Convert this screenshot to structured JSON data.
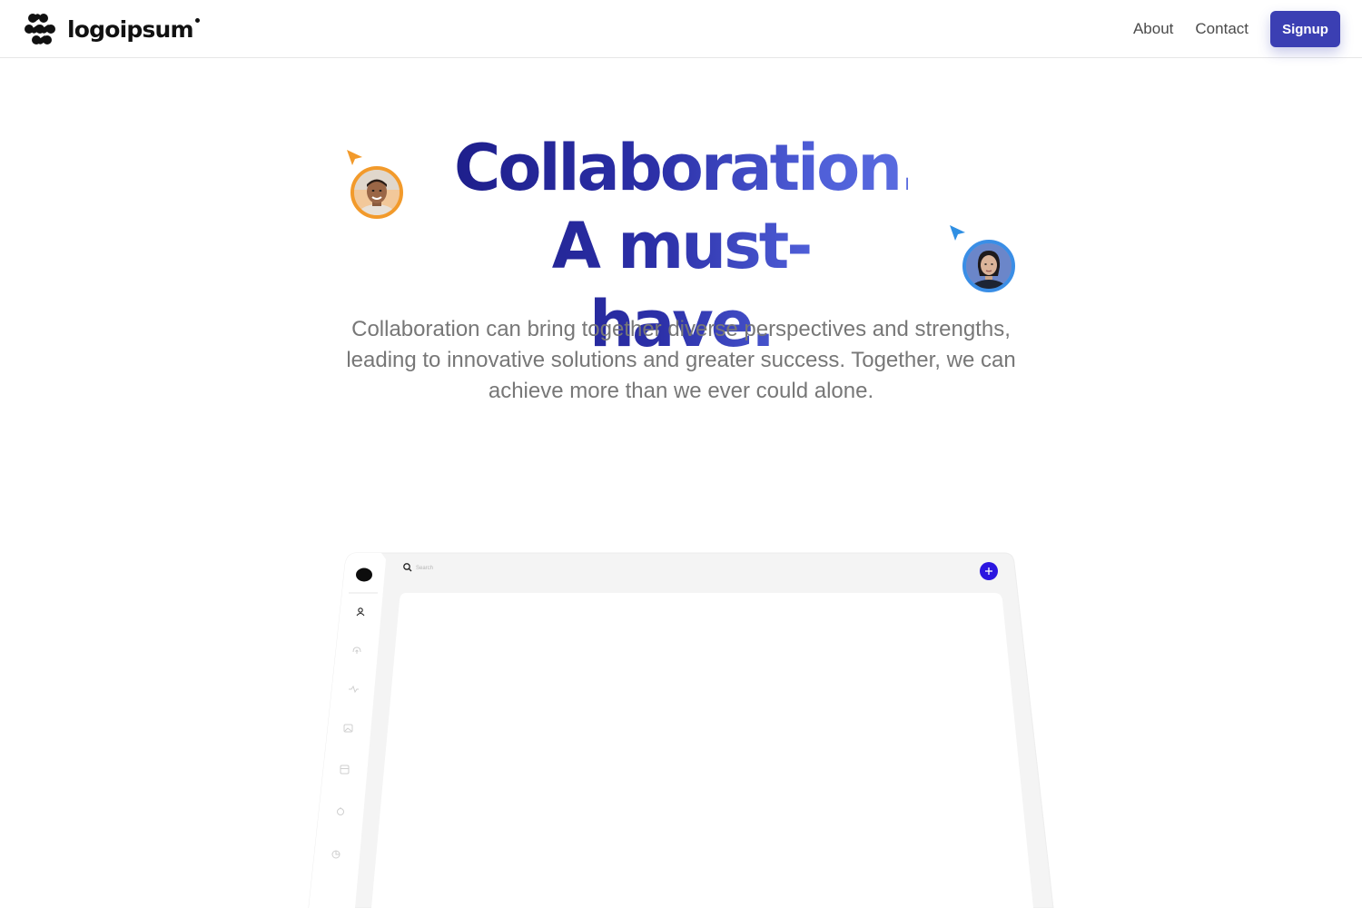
{
  "header": {
    "logo_text": "logoipsum",
    "nav": {
      "about": "About",
      "contact": "Contact",
      "signup": "Signup"
    }
  },
  "hero": {
    "title_line1": "Collaboration.",
    "title_line2": "A must-have.",
    "subtitle": "Collaboration can bring together diverse perspectives and strengths, leading to innovative solutions and greater success. Together, we can achieve more than we ever could alone."
  },
  "mockup": {
    "search_placeholder": "Search",
    "sidebar_icons": [
      "user-icon",
      "cloud-upload-icon",
      "activity-icon",
      "image-icon",
      "calendar-icon",
      "timer-icon",
      "pie-chart-icon"
    ],
    "add_button_icon": "plus-icon"
  },
  "colors": {
    "accent": "#3b3fb3",
    "title_gradient_start": "#1e1f8c",
    "title_gradient_end": "#5a6ce0",
    "cursor_orange": "#f29a2b",
    "cursor_blue": "#2f8fe3",
    "add_button": "#2b16e0"
  }
}
